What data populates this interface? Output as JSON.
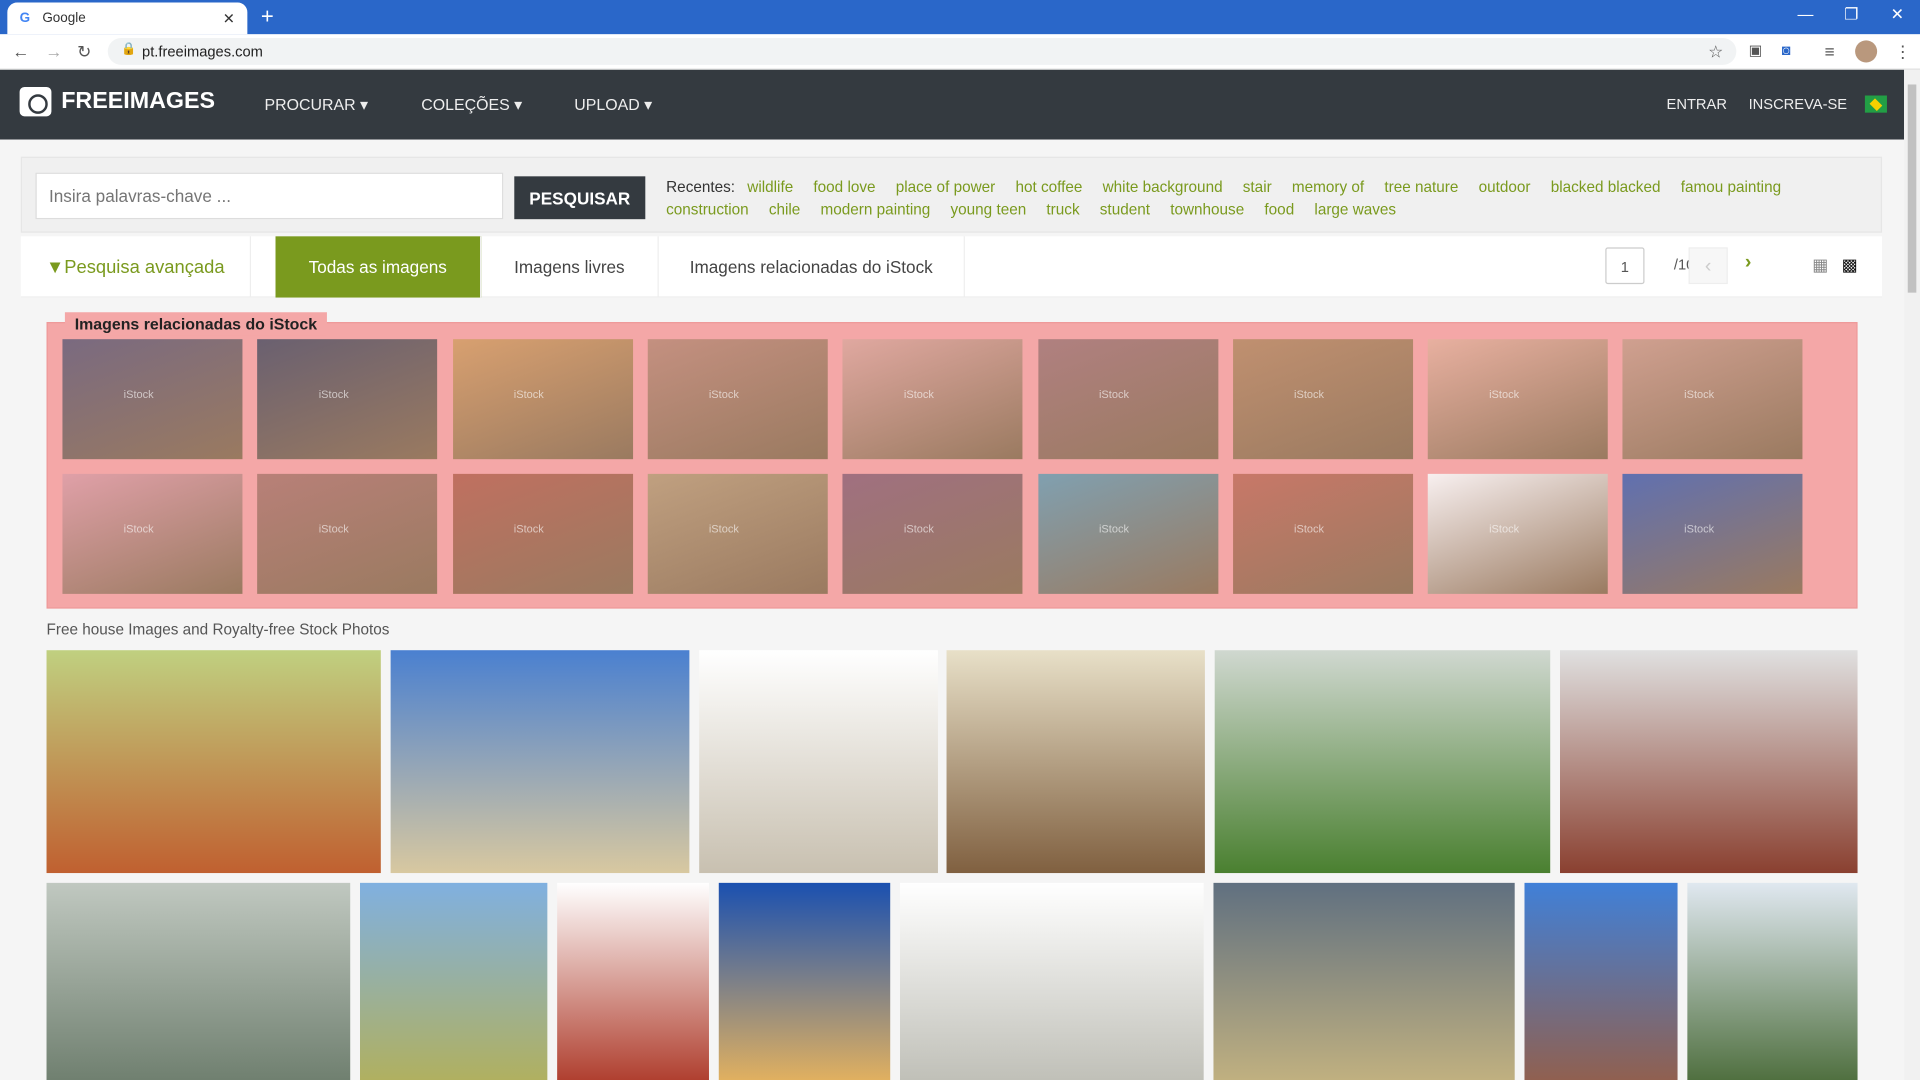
{
  "browser": {
    "tab_title": "Google",
    "url": "pt.freeimages.com"
  },
  "nav": {
    "logo": "FREEIMAGES",
    "menu": [
      "PROCURAR ▾",
      "COLEÇÕES ▾",
      "UPLOAD ▾"
    ],
    "login": "ENTRAR",
    "signup": "INSCREVA-SE",
    "flag": "brazil-flag-icon"
  },
  "search": {
    "placeholder": "Insira palavras-chave ...",
    "button": "PESQUISAR",
    "recent_label": "Recentes:",
    "recent": [
      "wildlife",
      "food love",
      "place of power",
      "hot coffee",
      "white background",
      "stair",
      "memory of",
      "tree nature",
      "outdoor",
      "blacked blacked",
      "famou painting",
      "construction",
      "chile",
      "modern painting",
      "young teen",
      "truck",
      "student",
      "townhouse",
      "food",
      "large waves"
    ]
  },
  "filters": {
    "advanced": "Pesquisa avançada",
    "tabs": [
      "Todas as imagens",
      "Imagens livres",
      "Imagens relacionadas do iStock"
    ],
    "active_tab": 0,
    "page": "1",
    "total": "/10"
  },
  "istock": {
    "label": "Imagens relacionadas do iStock",
    "watermark": "iStock"
  },
  "caption": "Free house Images and Royalty-free Stock Photos",
  "colors": {
    "accent": "#7a9a1e",
    "nav": "#343a40",
    "istock_bg": "#f4a7a7"
  }
}
